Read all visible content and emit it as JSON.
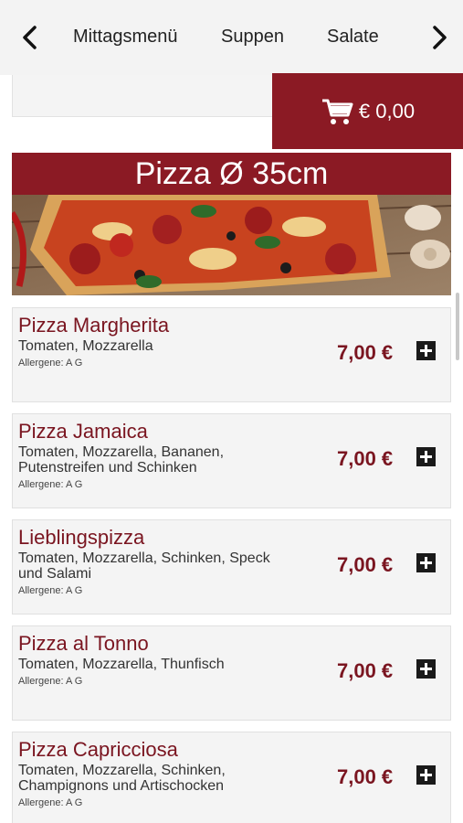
{
  "nav": {
    "items": [
      "Mittagsmenü",
      "Suppen",
      "Salate"
    ],
    "prev_icon": "chevron-left-icon",
    "next_icon": "chevron-right-icon"
  },
  "cart": {
    "icon": "cart-icon",
    "total": "€ 0,00"
  },
  "category": {
    "title": "Pizza Ø 35cm"
  },
  "products": [
    {
      "name": "Pizza Margherita",
      "description": "Tomaten, Mozzarella",
      "allergens": "Allergene: A G",
      "price": "7,00 €"
    },
    {
      "name": "Pizza Jamaica",
      "description": "Tomaten, Mozzarella, Bananen, Putenstreifen und Schinken",
      "allergens": "Allergene: A G",
      "price": "7,00 €"
    },
    {
      "name": "Lieblingspizza",
      "description": "Tomaten, Mozzarella, Schinken, Speck und Salami",
      "allergens": "Allergene: A G",
      "price": "7,00 €"
    },
    {
      "name": "Pizza al Tonno",
      "description": "Tomaten, Mozzarella, Thunfisch",
      "allergens": "Allergene: A G",
      "price": "7,00 €"
    },
    {
      "name": "Pizza Capricciosa",
      "description": "Tomaten, Mozzarella, Schinken, Champignons und Artischocken",
      "allergens": "Allergene: A G",
      "price": "7,00 €"
    }
  ],
  "colors": {
    "accent": "#8b1a24",
    "price": "#7a1520",
    "card_bg": "#f4f4f4"
  },
  "icons": {
    "add": "plus-icon"
  }
}
